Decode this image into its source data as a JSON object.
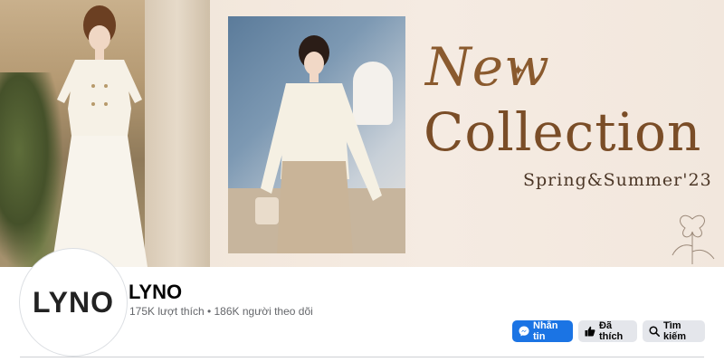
{
  "cover": {
    "title_line1": "New",
    "title_line2": "Collection",
    "subtitle": "Spring&Summer'23"
  },
  "page": {
    "avatar_text": "LYNO",
    "name": "LYNO",
    "stats": "175K lượt thích • 186K người theo dõi"
  },
  "actions": {
    "message_label": "Nhắn tin",
    "like_label": "Đã thích",
    "search_label": "Tìm kiếm"
  },
  "icons": {
    "message": "messenger-icon",
    "like": "thumbs-up-icon",
    "search": "search-icon"
  },
  "colors": {
    "primary_button": "#1b74e4",
    "secondary_button": "#e4e6eb",
    "banner_text": "#8a5a2e"
  }
}
